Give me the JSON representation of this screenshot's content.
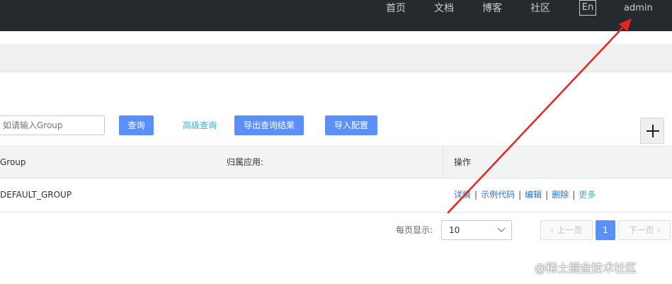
{
  "nav": {
    "home": "首页",
    "docs": "文档",
    "blog": "博客",
    "community": "社区",
    "lang": "En",
    "user": "admin"
  },
  "search": {
    "placeholder": "请输入Group",
    "placeholder_visible": "如请输入Group",
    "query_button": "查询",
    "advanced_link": "高级查询",
    "export_button": "导出查询结果",
    "import_button": "导入配置"
  },
  "table": {
    "headers": [
      "Group",
      "归属应用:",
      "操作"
    ],
    "rows": [
      {
        "group": "DEFAULT_GROUP",
        "app": "",
        "actions": [
          "详情",
          "示例代码",
          "编辑",
          "删除",
          "更多"
        ]
      }
    ]
  },
  "pagination": {
    "page_size_label": "每页显示:",
    "page_size": "10",
    "prev": "上一页",
    "current": "1",
    "next": "下一页"
  },
  "colors": {
    "primary": "#5b8ff9",
    "link": "#2874c5",
    "link_alt": "#30b7d2",
    "topbar": "#252a2f",
    "annotation": "#e8231d"
  },
  "watermark": "@稀土掘金技术社区"
}
